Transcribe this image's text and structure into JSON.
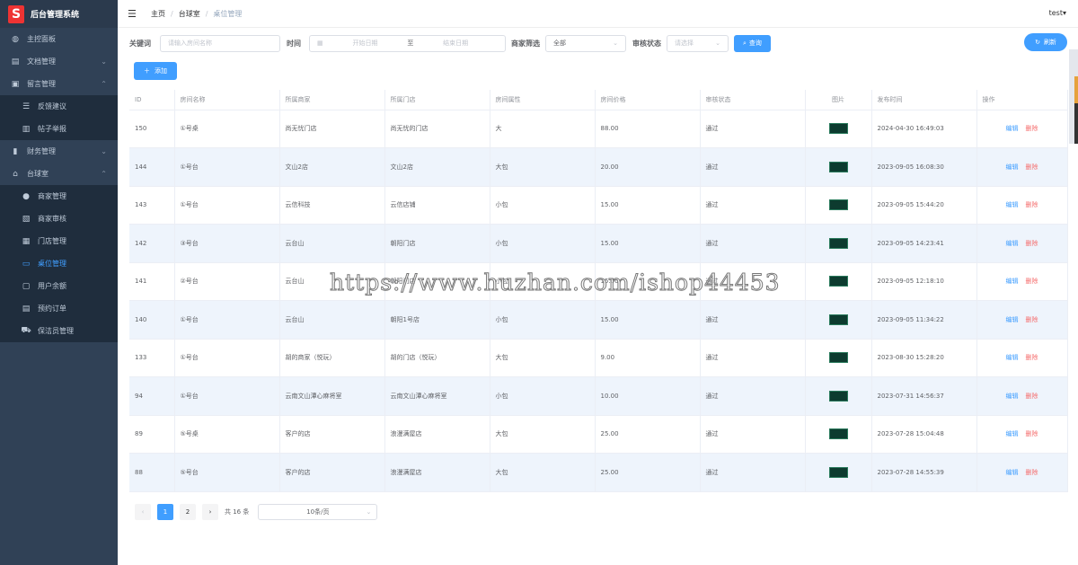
{
  "app": {
    "logo_letter": "S",
    "title": "后台管理系统"
  },
  "sidebar": {
    "items": [
      {
        "label": "主控面板",
        "icon": "dashboard-icon"
      },
      {
        "label": "文档管理",
        "icon": "document-icon",
        "arrow": "⌄"
      },
      {
        "label": "留言管理",
        "icon": "message-icon",
        "arrow": "⌃"
      },
      {
        "label": "反馈建议",
        "icon": "sliders-icon"
      },
      {
        "label": "帖子举报",
        "icon": "report-icon"
      },
      {
        "label": "财务管理",
        "icon": "chart-icon",
        "arrow": "⌄"
      },
      {
        "label": "台球室",
        "icon": "home-icon",
        "arrow": "⌃"
      },
      {
        "label": "商家管理",
        "icon": "user-icon"
      },
      {
        "label": "商家审核",
        "icon": "audit-icon"
      },
      {
        "label": "门店管理",
        "icon": "grid-icon"
      },
      {
        "label": "桌位管理",
        "icon": "table-icon"
      },
      {
        "label": "用户余额",
        "icon": "folder-icon"
      },
      {
        "label": "预约订单",
        "icon": "order-icon"
      },
      {
        "label": "保洁员管理",
        "icon": "cart-icon"
      }
    ]
  },
  "breadcrumb": {
    "home": "主页",
    "parent": "台球室",
    "current": "桌位管理"
  },
  "user": {
    "name": "test▾"
  },
  "filter": {
    "keyword_label": "关键词",
    "keyword_placeholder": "请输入房间名称",
    "time_label": "时间",
    "start_placeholder": "开始日期",
    "range_sep": "至",
    "end_placeholder": "结束日期",
    "merchant_label": "商家筛选",
    "merchant_value": "全部",
    "audit_label": "审核状态",
    "audit_placeholder": "请选择",
    "search_btn": "查询",
    "refresh_btn": "刷新",
    "add_btn": "添加"
  },
  "table": {
    "headers": [
      "ID",
      "房间名称",
      "所属商家",
      "所属门店",
      "房间属性",
      "房间价格",
      "审核状态",
      "图片",
      "发布时间",
      "操作"
    ],
    "rows": [
      [
        "150",
        "①号桌",
        "尚无忧门店",
        "尚无忧的门店",
        "大",
        "88.00",
        "通过",
        "2024-04-30 16:49:03"
      ],
      [
        "144",
        "①号台",
        "文山2店",
        "文山2店",
        "大包",
        "20.00",
        "通过",
        "2023-09-05 16:08:30"
      ],
      [
        "143",
        "①号台",
        "云信科技",
        "云信店铺",
        "小包",
        "15.00",
        "通过",
        "2023-09-05 15:44:20"
      ],
      [
        "142",
        "③号台",
        "云台山",
        "朝阳门店",
        "小包",
        "15.00",
        "通过",
        "2023-09-05 14:23:41"
      ],
      [
        "141",
        "②号台",
        "云台山",
        "朝阳门店",
        "小包",
        "15.00",
        "通过",
        "2023-09-05 12:18:10"
      ],
      [
        "140",
        "①号台",
        "云台山",
        "朝阳1号店",
        "小包",
        "15.00",
        "通过",
        "2023-09-05 11:34:22"
      ],
      [
        "133",
        "①号台",
        "胡的商家（悦玩）",
        "胡的门店（悦玩）",
        "大包",
        "9.00",
        "通过",
        "2023-08-30 15:28:20"
      ],
      [
        "94",
        "①号台",
        "云南文山潭心麻将室",
        "云南文山潭心麻将室",
        "小包",
        "10.00",
        "通过",
        "2023-07-31 14:56:37"
      ],
      [
        "89",
        "⑤号桌",
        "客户的店",
        "浪漫满屋店",
        "大包",
        "25.00",
        "通过",
        "2023-07-28 15:04:48"
      ],
      [
        "88",
        "⑤号台",
        "客户的店",
        "浪漫满屋店",
        "大包",
        "25.00",
        "通过",
        "2023-07-28 14:55:39"
      ]
    ],
    "edit_label": "编辑",
    "delete_label": "删除"
  },
  "pagination": {
    "prev": "‹",
    "pages": [
      "1",
      "2"
    ],
    "next": "›",
    "total": "共 16 条",
    "page_size": "10条/页"
  },
  "watermark": "https://www.huzhan.com/ishop44453"
}
